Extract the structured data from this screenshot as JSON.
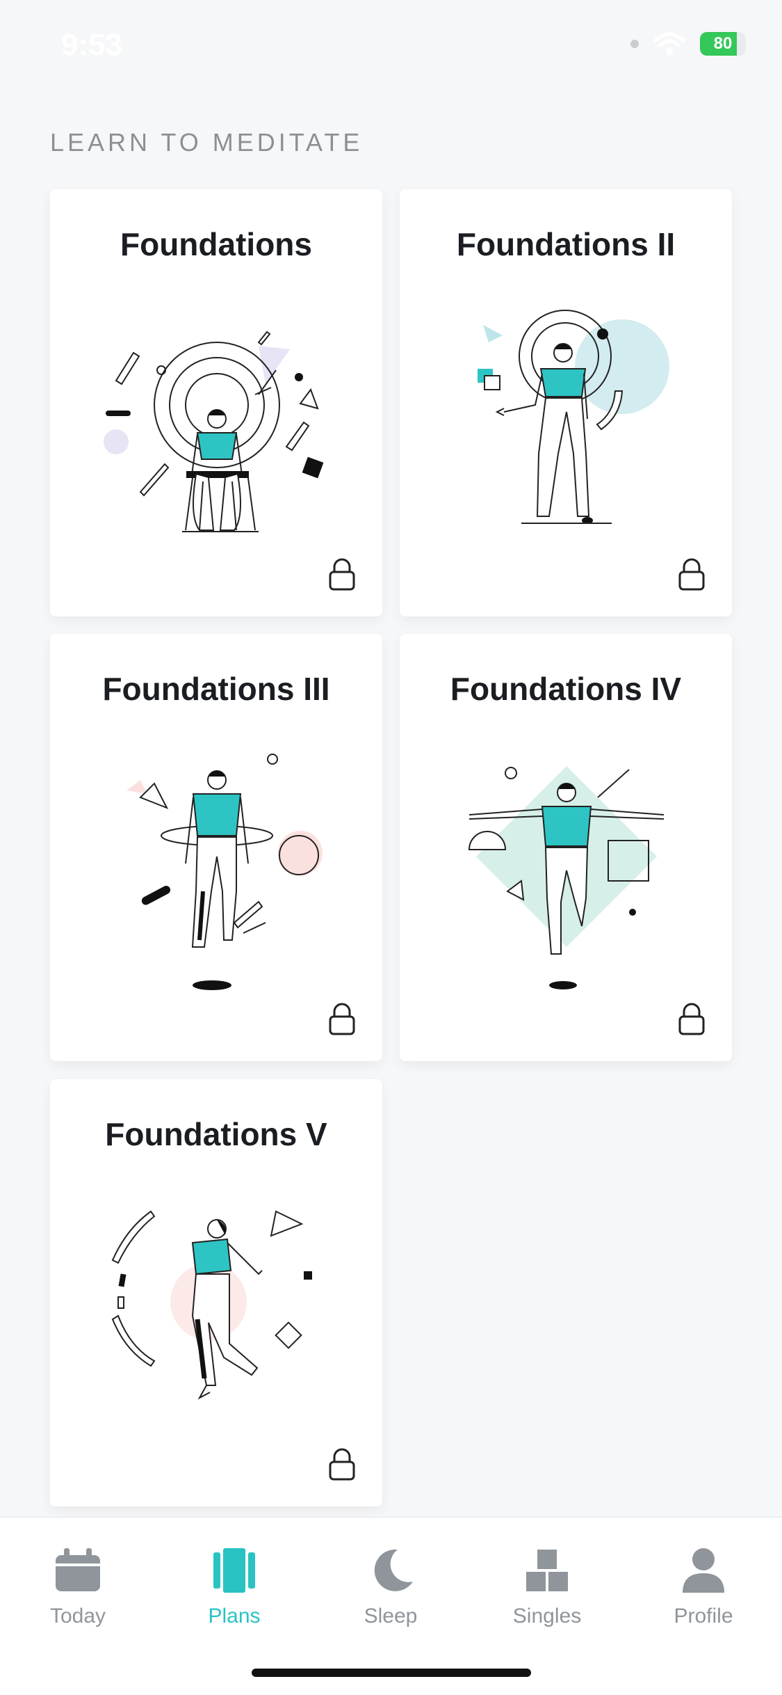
{
  "status": {
    "time": "9:53",
    "battery": "80",
    "battery_level": 0.8
  },
  "section": {
    "title": "LEARN TO MEDITATE"
  },
  "plans": [
    {
      "title": "Foundations"
    },
    {
      "title": "Foundations II"
    },
    {
      "title": "Foundations III"
    },
    {
      "title": "Foundations IV"
    },
    {
      "title": "Foundations V"
    }
  ],
  "tabs": [
    {
      "label": "Today",
      "icon": "calendar-icon"
    },
    {
      "label": "Plans",
      "icon": "plans-icon",
      "active": true
    },
    {
      "label": "Sleep",
      "icon": "moon-icon"
    },
    {
      "label": "Singles",
      "icon": "boxes-icon"
    },
    {
      "label": "Profile",
      "icon": "person-icon"
    }
  ],
  "colors": {
    "accent": "#29c3c3",
    "tab_inactive": "#8f959b",
    "lavender": "#e6e4f5",
    "pink": "#fbe1de",
    "mint": "#d6efe9",
    "teal_light": "#d3ecef"
  }
}
